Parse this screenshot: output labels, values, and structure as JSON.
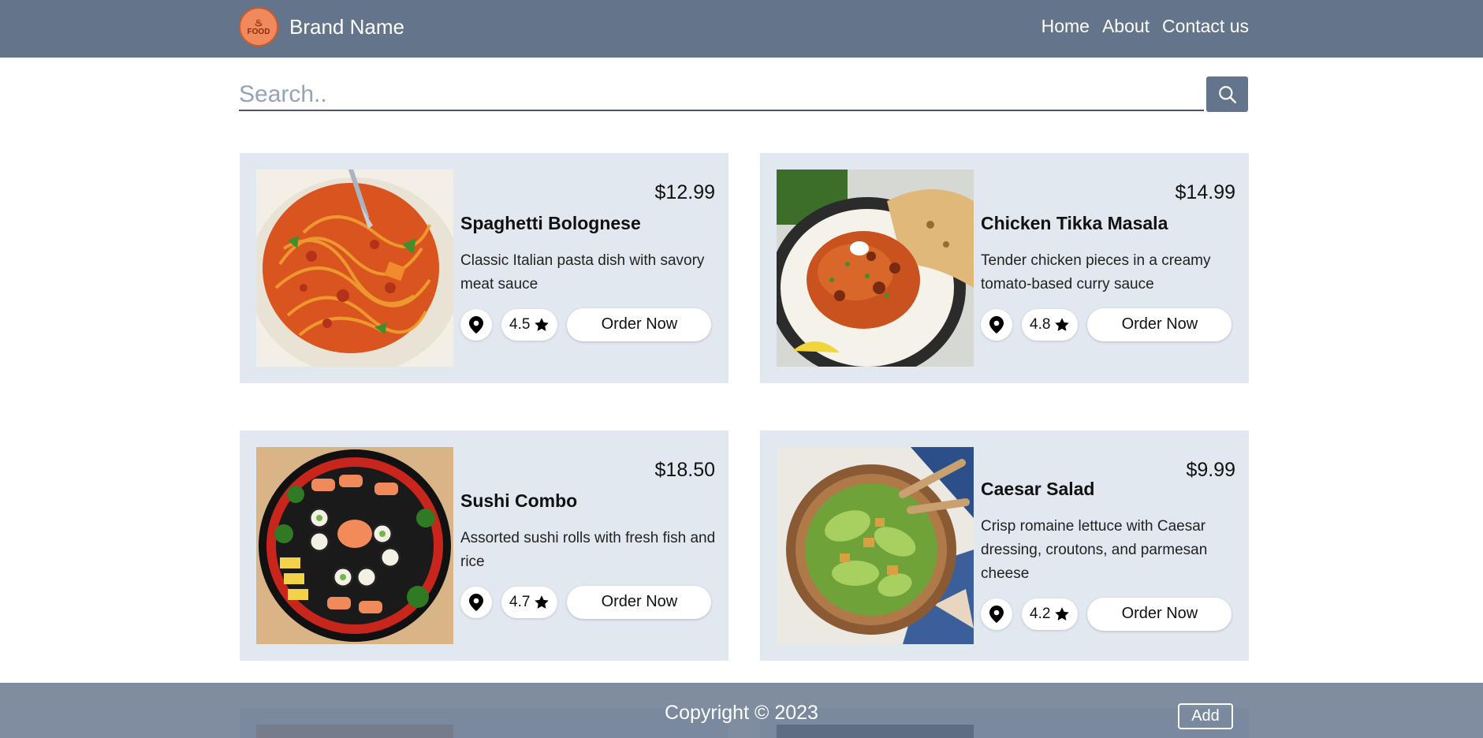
{
  "navbar": {
    "brand_name": "Brand Name",
    "logo_text": "FOOD",
    "links": [
      "Home",
      "About",
      "Contact us"
    ]
  },
  "search": {
    "placeholder": "Search.."
  },
  "items": [
    {
      "title": "Spaghetti Bolognese",
      "price": "$12.99",
      "description": "Classic Italian pasta dish with savory meat sauce",
      "rating": "4.5",
      "order_label": "Order Now"
    },
    {
      "title": "Chicken Tikka Masala",
      "price": "$14.99",
      "description": "Tender chicken pieces in a creamy tomato-based curry sauce",
      "rating": "4.8",
      "order_label": "Order Now"
    },
    {
      "title": "Sushi Combo",
      "price": "$18.50",
      "description": "Assorted sushi rolls with fresh fish and rice",
      "rating": "4.7",
      "order_label": "Order Now"
    },
    {
      "title": "Caesar Salad",
      "price": "$9.99",
      "description": "Crisp romaine lettuce with Caesar dressing, croutons, and parmesan cheese",
      "rating": "4.2",
      "order_label": "Order Now"
    }
  ],
  "footer": {
    "copyright": "Copyright © 2023",
    "add_label": "Add"
  },
  "colors": {
    "navbar": "#64748b",
    "card": "#e2e8f0",
    "logo": "#f08a5d"
  }
}
